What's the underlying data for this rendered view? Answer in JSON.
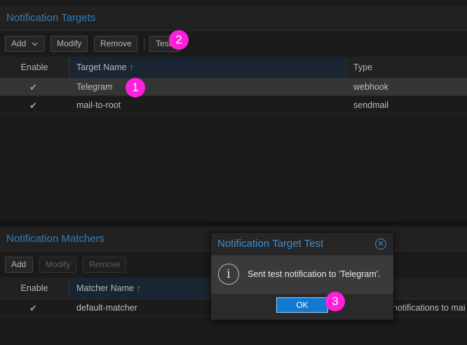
{
  "targets_panel": {
    "title": "Notification Targets",
    "toolbar": {
      "add": "Add",
      "modify": "Modify",
      "remove": "Remove",
      "test": "Test"
    },
    "columns": {
      "enable": "Enable",
      "name": "Target Name",
      "type": "Type",
      "sort_indicator": "↑"
    },
    "rows": [
      {
        "enabled": "✔",
        "name": "Telegram",
        "type": "webhook",
        "selected": true
      },
      {
        "enabled": "✔",
        "name": "mail-to-root",
        "type": "sendmail",
        "selected": false
      }
    ]
  },
  "matchers_panel": {
    "title": "Notification Matchers",
    "toolbar": {
      "add": "Add",
      "modify": "Modify",
      "remove": "Remove"
    },
    "columns": {
      "enable": "Enable",
      "name": "Matcher Name",
      "sort_indicator": "↑"
    },
    "rows": [
      {
        "enabled": "✔",
        "name": "default-matcher",
        "comment": "notifications to mai"
      }
    ]
  },
  "dialog": {
    "title": "Notification Target Test",
    "icon_glyph": "i",
    "close_glyph": "✕",
    "message": "Sent test notification to 'Telegram'.",
    "ok": "OK"
  },
  "markers": {
    "m1": "1",
    "m2": "2",
    "m3": "3"
  },
  "icons": {
    "check": "check-icon",
    "info": "info-icon",
    "dropdown": "chevron-down-icon",
    "close": "close-icon"
  },
  "colors": {
    "accent": "#3c8ed0",
    "marker": "#ff1fdc",
    "ok_button": "#1278d0"
  }
}
